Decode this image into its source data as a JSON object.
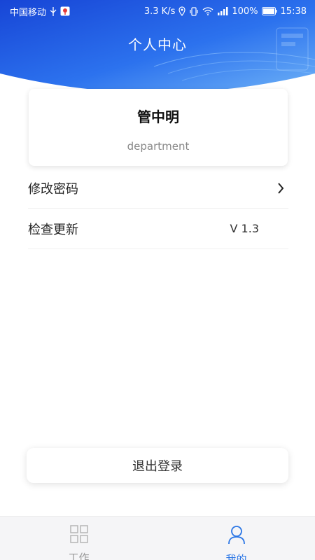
{
  "status_bar": {
    "carrier": "中国移动",
    "speed": "3.3 K/s",
    "battery": "100%",
    "time": "15:38"
  },
  "header": {
    "title": "个人中心"
  },
  "profile": {
    "name": "管中明",
    "department": "department"
  },
  "menu": {
    "change_password": "修改密码",
    "check_update": "检查更新",
    "version": "V 1.3"
  },
  "logout": {
    "label": "退出登录"
  },
  "tabbar": {
    "work": "工作",
    "mine": "我的"
  },
  "colors": {
    "header_blue": "#1a4fd8",
    "accent": "#2b76e5"
  }
}
